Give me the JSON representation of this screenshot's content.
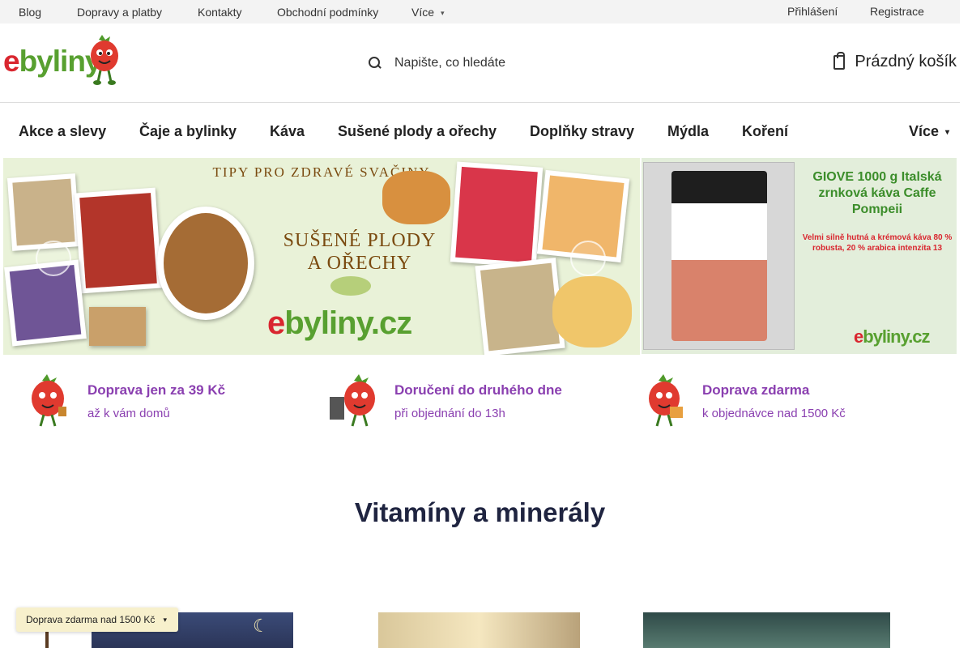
{
  "topbar": {
    "links": [
      "Blog",
      "Dopravy a platby",
      "Kontakty",
      "Obchodní podmínky",
      "Více"
    ],
    "login": "Přihlášení",
    "register": "Registrace"
  },
  "header": {
    "logo_e": "e",
    "logo_rest": "byliny",
    "search_placeholder": "Napište, co hledáte",
    "cart_label": "Prázdný košík"
  },
  "nav": {
    "items": [
      "Akce a slevy",
      "Čaje a bylinky",
      "Káva",
      "Sušené plody a ořechy",
      "Doplňky stravy",
      "Mýdla",
      "Koření",
      "Více"
    ]
  },
  "banner_main": {
    "headline": "TIPY PRO ZDRAVÉ SVAČINY",
    "title_line1": "SUŠENÉ PLODY",
    "title_line2": "A OŘECHY",
    "brand_e": "e",
    "brand_rest": "byliny.cz"
  },
  "banner_side": {
    "title": "GIOVE 1000 g Italská zrnková káva Caffe Pompeii",
    "desc": "Velmi silně hutná a krémová káva 80 % robusta, 20 % arabica intenzita 13",
    "brand_e": "e",
    "brand_rest": "byliny.cz"
  },
  "benefits": [
    {
      "title": "Doprava jen za 39 Kč",
      "sub": "až k vám domů"
    },
    {
      "title": "Doručení do druhého dne",
      "sub": "při objednání do 13h"
    },
    {
      "title": "Doprava zdarma",
      "sub": "k objednávce nad 1500 Kč"
    }
  ],
  "section": {
    "title": "Vitamíny a minerály"
  },
  "promo": {
    "label": "Doprava zdarma nad 1500 Kč"
  },
  "colors": {
    "brand_red": "#d9262f",
    "brand_green": "#58a030",
    "benefit_purple": "#8a3fb0",
    "title_navy": "#1f2440"
  }
}
